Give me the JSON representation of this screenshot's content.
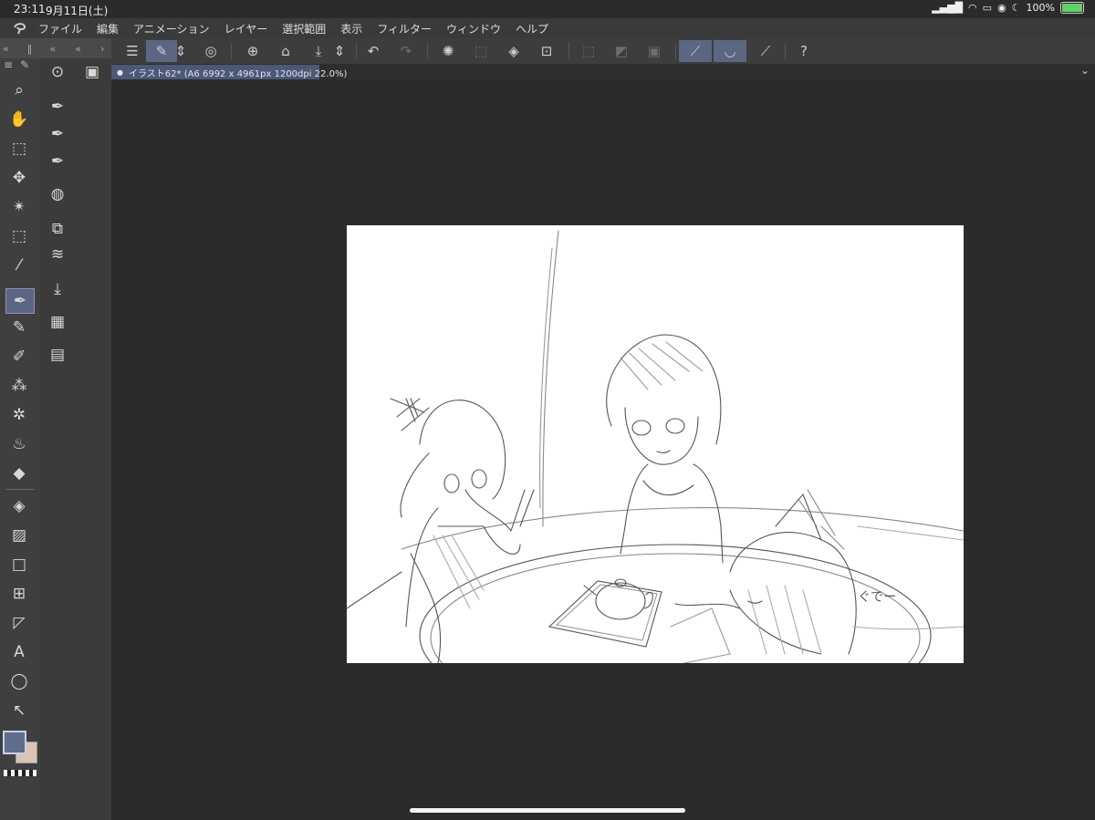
{
  "status": {
    "time": "23:11",
    "date": "9月11日(土)",
    "battery": "100%"
  },
  "menu": {
    "items": [
      "ファイル",
      "編集",
      "アニメーション",
      "レイヤー",
      "選択範囲",
      "表示",
      "フィルター",
      "ウィンドウ",
      "ヘルプ"
    ]
  },
  "document": {
    "tab_label": "イラスト62* (A6 6992 x 4961px 1200dpi 22.0%)"
  },
  "colors": {
    "main": "#5e6d8c",
    "sub": "#dbc3b6"
  },
  "annotation": {
    "text": "ぐでー"
  }
}
